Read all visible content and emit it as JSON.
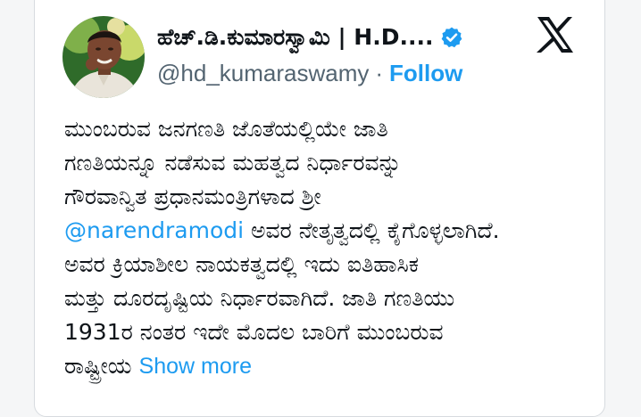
{
  "user": {
    "display_name": "ಹೆಚ್.ಡಿ.ಕುಮಾರಸ್ವಾಮಿ | H.D....",
    "handle": "@hd_kumaraswamy",
    "separator": "·",
    "follow_label": "Follow",
    "avatar_icon": "profile-photo-icon",
    "verified_icon": "verified-badge-icon",
    "verified_color": "#1d9bf0"
  },
  "brand": {
    "logo_icon": "x-logo-icon",
    "color": "#0f1419"
  },
  "tweet": {
    "text_part1": "ಮುಂಬರುವ ಜನಗಣತಿ ಜೊತೆಯಲ್ಲಿಯೇ ಜಾತಿ\nಗಣತಿಯನ್ನೂ ನಡೆಸುವ ಮಹತ್ವದ ನಿರ್ಧಾರವನ್ನು\nಗೌರವಾನ್ವಿತ ಪ್ರಧಾನಮಂತ್ರಿಗಳಾದ ಶ್ರೀ\n",
    "mention": "@narendramodi",
    "text_part2": " ಅವರ ನೇತೃತ್ವದಲ್ಲಿ ಕೈಗೊಳ್ಳಲಾಗಿದೆ.\nಅವರ ಕ್ರಿಯಾಶೀಲ ನಾಯಕತ್ವದಲ್ಲಿ ಇದು ಐತಿಹಾಸಿಕ\nಮತ್ತು ದೂರದೃಷ್ಟಿಯ ನಿರ್ಧಾರವಾಗಿದೆ. ಜಾತಿ ಗಣತಿಯು\n1931ರ ನಂತರ ಇದೇ ಮೊದಲ ಬಾರಿಗೆ ಮುಂಬರುವ\nರಾಷ್ಟ್ರೀಯ ",
    "show_more": "Show more",
    "link_color": "#1d9bf0",
    "text_color": "#0f1419"
  }
}
